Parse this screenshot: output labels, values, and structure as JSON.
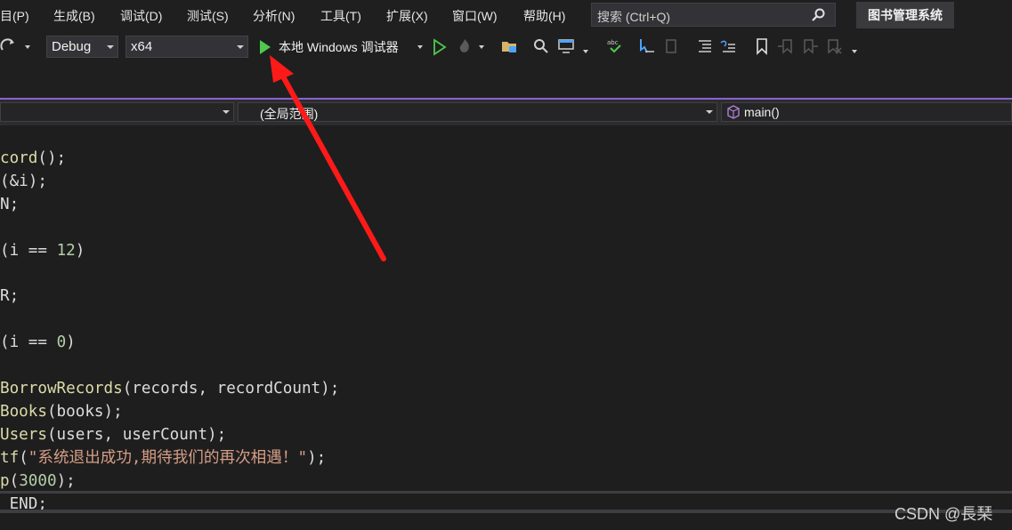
{
  "menu": {
    "items": [
      "目(P)",
      "生成(B)",
      "调试(D)",
      "测试(S)",
      "分析(N)",
      "工具(T)",
      "扩展(X)",
      "窗口(W)",
      "帮助(H)"
    ],
    "search_placeholder": "搜索 (Ctrl+Q)",
    "app_title": "图书管理系统"
  },
  "toolbar": {
    "config": "Debug",
    "platform": "x64",
    "run_label": "本地 Windows 调试器",
    "icons": [
      "redo-icon",
      "start-debug-icon",
      "start-without-debug-icon",
      "hot-reload-icon",
      "open-folder-icon",
      "find-icon",
      "window-layout-icon",
      "spellcheck-icon",
      "comment-icon",
      "uncomment-icon",
      "indent-icon",
      "outdent-icon",
      "bookmark-icon",
      "prev-bookmark-icon",
      "next-bookmark-icon",
      "clear-bookmark-icon"
    ]
  },
  "navbar": {
    "scope": "(全局范围)",
    "member": "main()"
  },
  "code": {
    "lines": [
      [
        {
          "t": "cord",
          "c": "fn"
        },
        {
          "t": "();",
          "c": "pl"
        }
      ],
      [
        {
          "t": "(&i);",
          "c": "pl"
        }
      ],
      [
        {
          "t": "N;",
          "c": "pl"
        }
      ],
      [],
      [
        {
          "t": "(i == ",
          "c": "pl"
        },
        {
          "t": "12",
          "c": "num"
        },
        {
          "t": ")",
          "c": "pl"
        }
      ],
      [],
      [
        {
          "t": "R;",
          "c": "pl"
        }
      ],
      [],
      [
        {
          "t": "(i == ",
          "c": "pl"
        },
        {
          "t": "0",
          "c": "num"
        },
        {
          "t": ")",
          "c": "pl"
        }
      ],
      [],
      [
        {
          "t": "BorrowRecords",
          "c": "fn"
        },
        {
          "t": "(records, recordCount);",
          "c": "pl"
        }
      ],
      [
        {
          "t": "Books",
          "c": "fn"
        },
        {
          "t": "(books);",
          "c": "pl"
        }
      ],
      [
        {
          "t": "Users",
          "c": "fn"
        },
        {
          "t": "(users, userCount);",
          "c": "pl"
        }
      ],
      [
        {
          "t": "tf",
          "c": "fn"
        },
        {
          "t": "(",
          "c": "pl"
        },
        {
          "t": "\"系统退出成功,期待我们的再次相遇！\"",
          "c": "str"
        },
        {
          "t": ");",
          "c": "pl"
        }
      ],
      [
        {
          "t": "p",
          "c": "fn"
        },
        {
          "t": "(",
          "c": "pl"
        },
        {
          "t": "3000",
          "c": "num"
        },
        {
          "t": ");",
          "c": "pl"
        }
      ],
      [
        {
          "t": " END;",
          "c": "pl"
        }
      ]
    ]
  },
  "colors": {
    "accent": "#8a63d2",
    "run_green": "#4ec94e",
    "annotation_arrow": "#ff1a1a"
  },
  "watermark": "CSDN @長琹"
}
